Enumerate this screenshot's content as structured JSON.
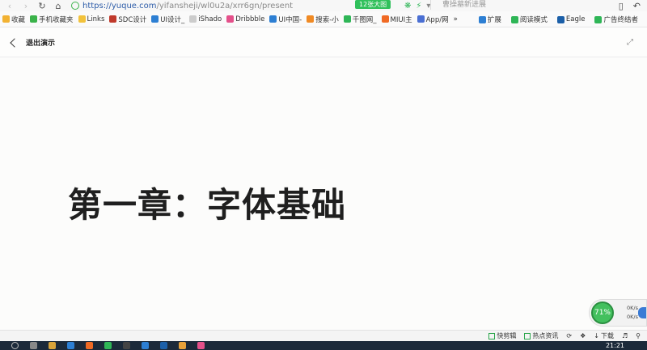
{
  "browser": {
    "url_host": "https://yuque.com",
    "url_path": "/yifansheji/wl0u2a/xrr6gn/present",
    "speed_badge": "12张大图",
    "search_placeholder": "曹操墓新进展"
  },
  "bookmarks": [
    {
      "label": "收藏",
      "color": "#f2b233"
    },
    {
      "label": "手机收藏夹",
      "color": "#3bb34a"
    },
    {
      "label": "Links",
      "color": "#f2c23b"
    },
    {
      "label": "SDC设计",
      "color": "#c0392b"
    },
    {
      "label": "UI设计_",
      "color": "#2d7fd3"
    },
    {
      "label": "iShado",
      "color": "#cccccc"
    },
    {
      "label": "Dribbble",
      "color": "#e4508a"
    },
    {
      "label": "UI中国-",
      "color": "#2d7fd3"
    },
    {
      "label": "搜索-小",
      "color": "#f08a24"
    },
    {
      "label": "千图网_",
      "color": "#2fb657"
    },
    {
      "label": "MIUI主",
      "color": "#f06a24"
    },
    {
      "label": "App/网",
      "color": "#4a6fd3"
    },
    {
      "label": "»",
      "color": ""
    }
  ],
  "bookmarks_right": [
    {
      "label": "扩展",
      "color": "#2d7fd3"
    },
    {
      "label": "阅读模式",
      "color": "#2fb657"
    },
    {
      "label": "Eagle",
      "color": "#1b5fa8"
    },
    {
      "label": "广告终结者",
      "color": "#2fb657"
    }
  ],
  "presentation": {
    "exit_label": "退出演示",
    "slide_title": "第一章：字体基础"
  },
  "speed_widget": {
    "percent": "71%",
    "up": "0K/s",
    "down": "0K/s"
  },
  "status_bar": {
    "items": [
      "快剪辑",
      "热点资讯",
      "下载"
    ]
  },
  "taskbar": {
    "clock": "21:21"
  }
}
